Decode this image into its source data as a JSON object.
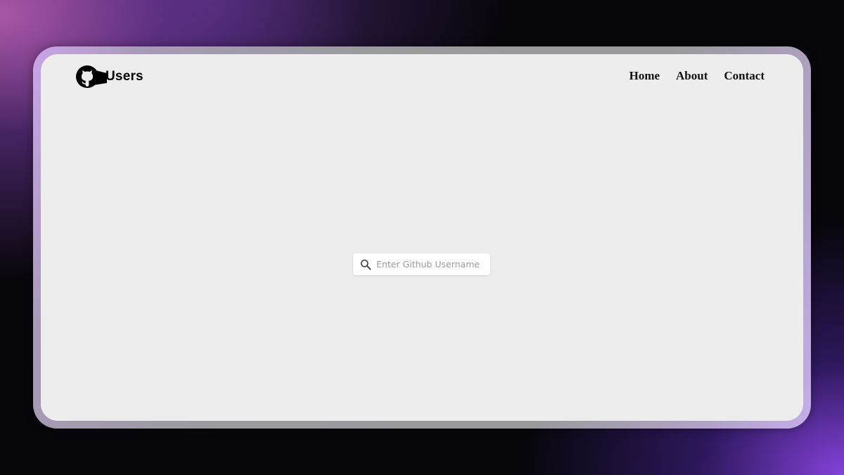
{
  "brand": {
    "text": "Users",
    "logo_icon": "github-octocat-icon"
  },
  "nav": {
    "items": [
      {
        "label": "Home"
      },
      {
        "label": "About"
      },
      {
        "label": "Contact"
      }
    ]
  },
  "search": {
    "placeholder": "Enter Github Username",
    "value": "",
    "icon": "search-icon"
  },
  "colors": {
    "window_background": "#ededed",
    "text": "#111111",
    "placeholder": "#9a9a9a",
    "accent_glow": "#8c46e6"
  }
}
